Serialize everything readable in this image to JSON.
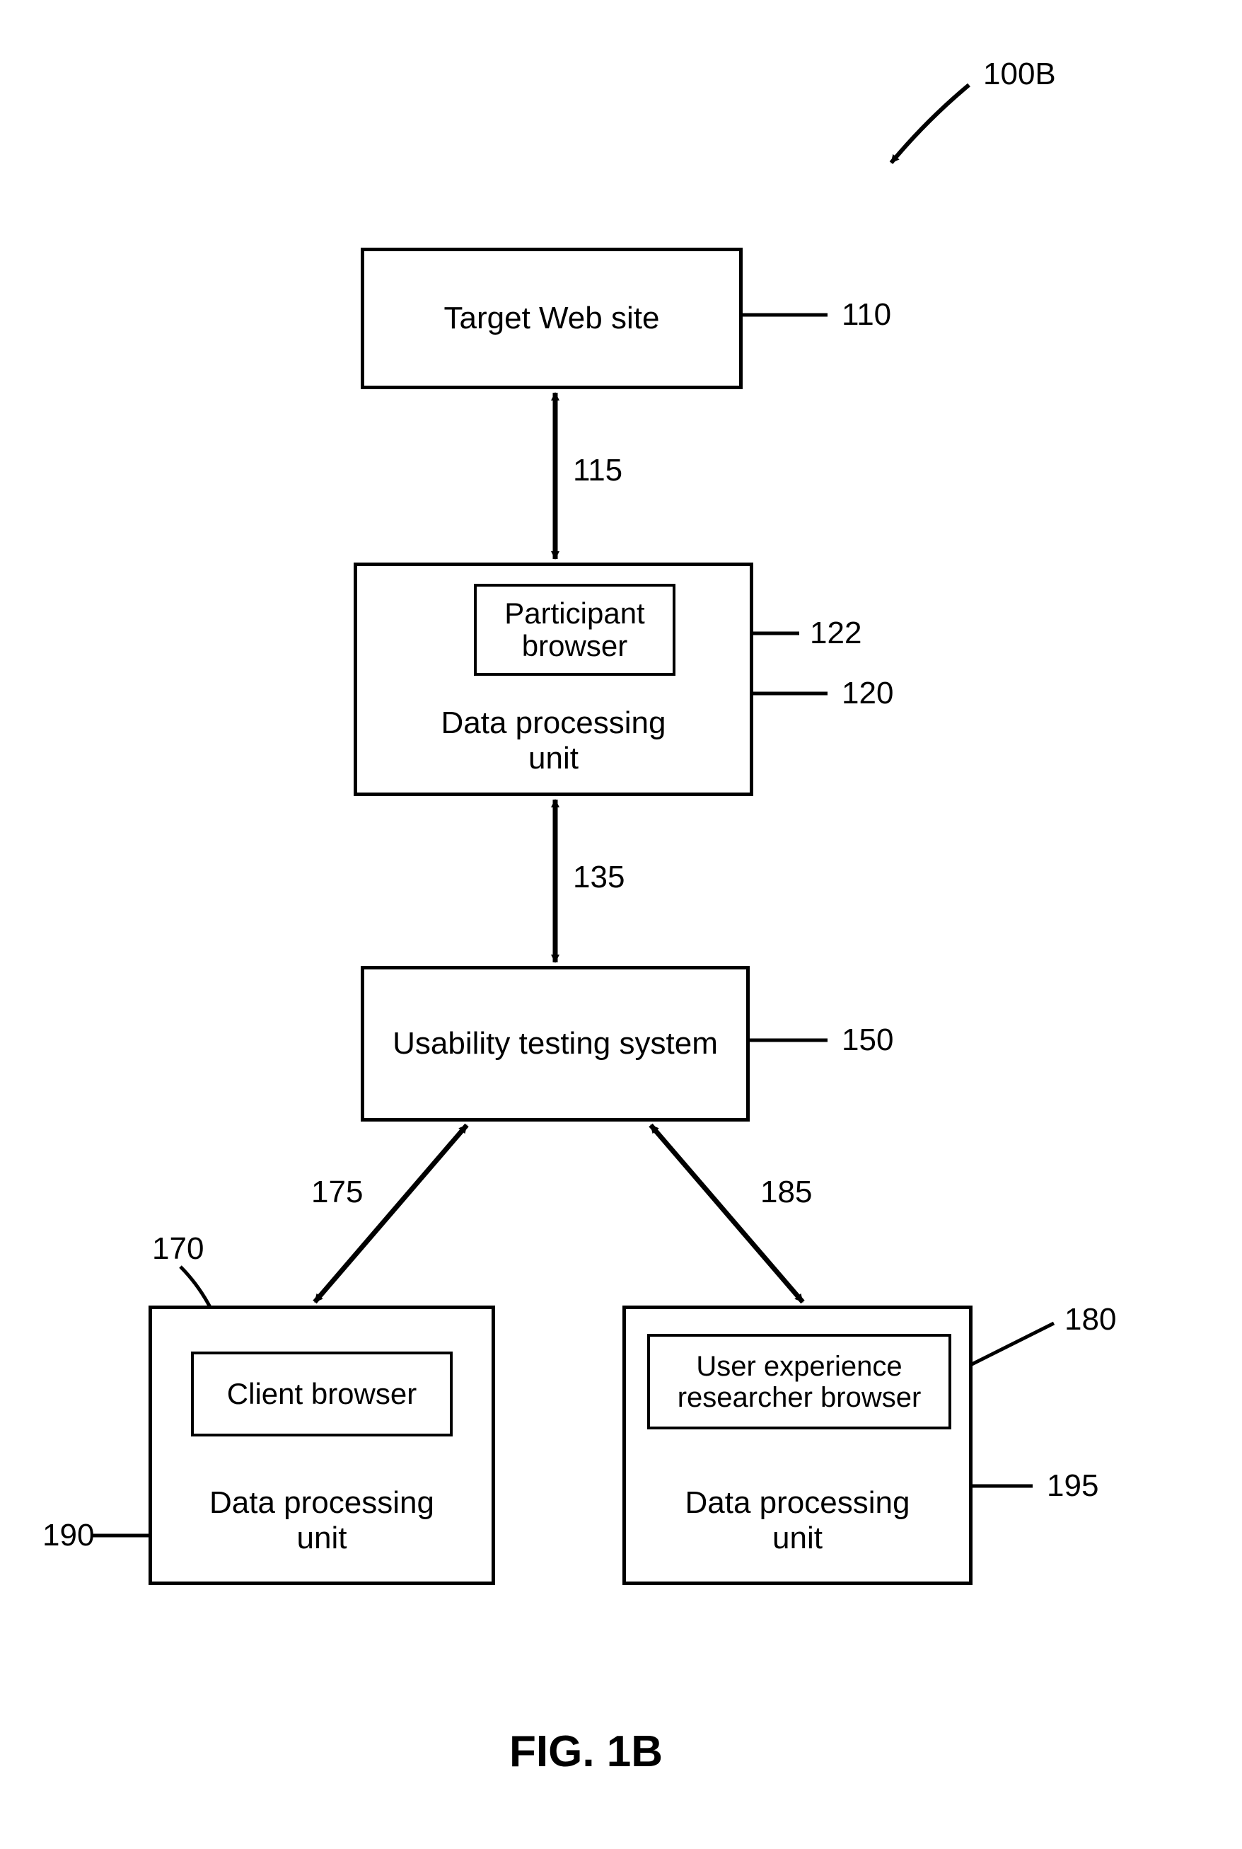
{
  "figure": {
    "ref": "100B",
    "caption": "FIG. 1B"
  },
  "boxes": {
    "target": {
      "label": "Target Web site",
      "ref": "110"
    },
    "participant_dpu": {
      "label": "Data processing\nunit",
      "ref": "120"
    },
    "participant_browser": {
      "label": "Participant\nbrowser",
      "ref": "122"
    },
    "usability": {
      "label": "Usability testing system",
      "ref": "150"
    },
    "client_dpu": {
      "label": "Data processing\nunit",
      "ref": "190"
    },
    "client_browser": {
      "label": "Client browser",
      "ref": "170"
    },
    "ux_dpu": {
      "label": "Data processing\nunit",
      "ref": "195"
    },
    "ux_browser": {
      "label": "User experience\nresearcher browser",
      "ref": "180"
    }
  },
  "connectors": {
    "c115": "115",
    "c135": "135",
    "c175": "175",
    "c185": "185"
  }
}
